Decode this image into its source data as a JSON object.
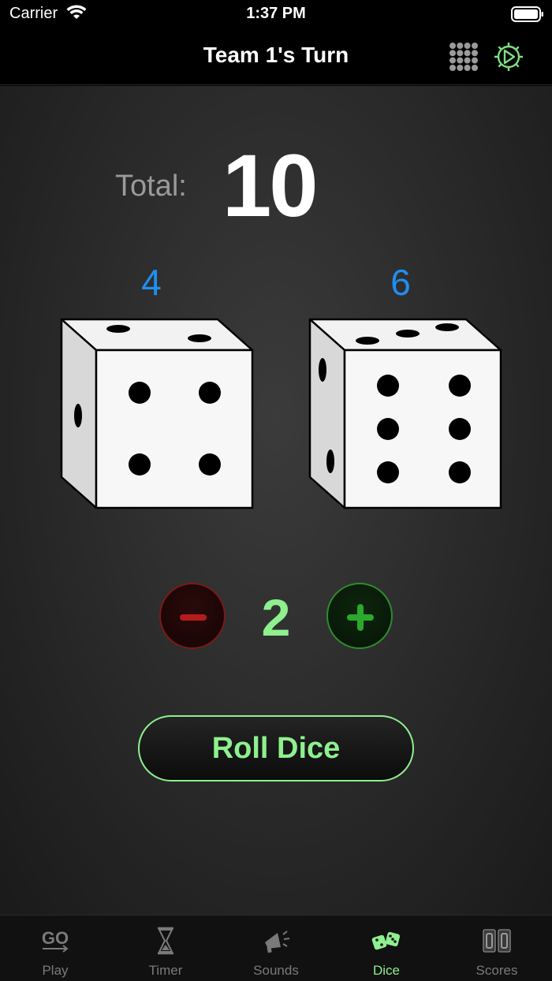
{
  "status_bar": {
    "carrier": "Carrier",
    "time": "1:37 PM"
  },
  "nav": {
    "title": "Team 1's Turn",
    "icons": [
      "grid-icon",
      "gear-icon"
    ]
  },
  "main": {
    "total_label": "Total:",
    "total_value": "10",
    "dice": [
      {
        "value": "4",
        "pips": 4
      },
      {
        "value": "6",
        "pips": 6
      }
    ],
    "dice_count": "2",
    "roll_label": "Roll Dice"
  },
  "tabs": [
    {
      "label": "Play",
      "icon": "play-icon",
      "active": false
    },
    {
      "label": "Timer",
      "icon": "hourglass-icon",
      "active": false
    },
    {
      "label": "Sounds",
      "icon": "megaphone-icon",
      "active": false
    },
    {
      "label": "Dice",
      "icon": "dice-icon",
      "active": true
    },
    {
      "label": "Scores",
      "icon": "scoreboard-icon",
      "active": false
    }
  ],
  "colors": {
    "accent_green": "#8ef08e",
    "die_value_blue": "#1f8ff0",
    "minus_red": "#b41c1c",
    "plus_green": "#2ca82c"
  }
}
